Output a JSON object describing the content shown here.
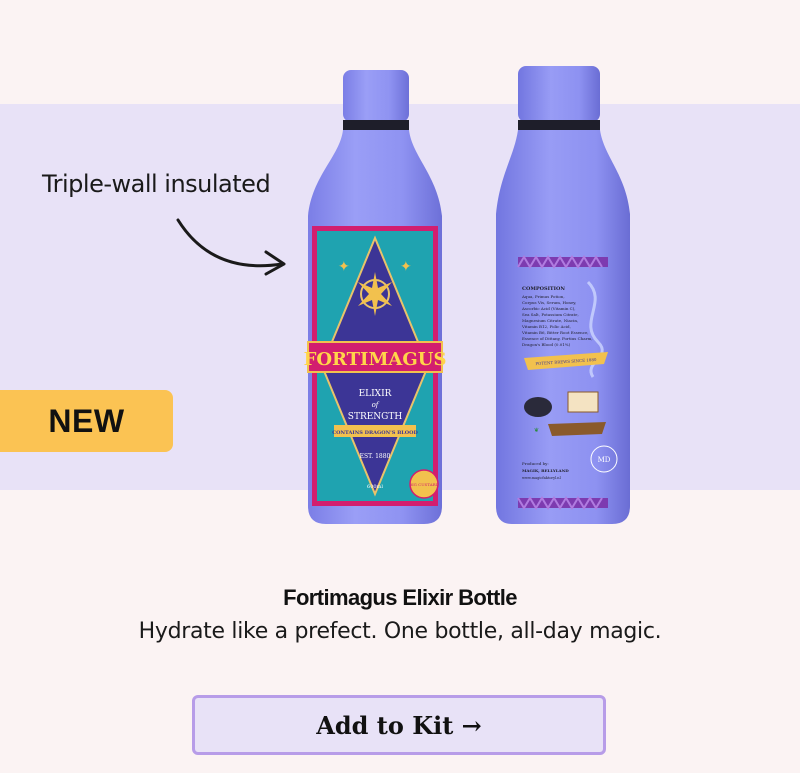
{
  "annotation": {
    "text": "Triple-wall insulated"
  },
  "badge": {
    "label": "NEW"
  },
  "product": {
    "title": "Fortimagus Elixir Bottle",
    "subtitle": "Hydrate like a prefect. One bottle, all-day magic.",
    "bottle_color": "#8f93f2"
  },
  "label_front": {
    "brand": "FORTIMAGUS",
    "line1": "ELIXIR",
    "line2": "of",
    "line3": "STRENGTH",
    "ribbon": "CONTAINS DRAGON'S BLOOD",
    "est": "EST. 1880",
    "volume": "600ml",
    "seal": "BIG CUSTARD"
  },
  "label_back": {
    "heading": "COMPOSITION",
    "ingredients": [
      "Aqua, Primus Potion,",
      "Corpus Vis, Serum, Honey,",
      "Ascorbic Acid (Vitamin C),",
      "Sea Salt, Potassium Citrate,",
      "Magnesium Citrate, Niacin,",
      "Vitamin B12, Folic Acid,",
      "Vitamin B6, Bitter Root Essence,",
      "Essence of Dittany, Fortius Charm,",
      "Dragon's Blood (0.01%)"
    ],
    "banner": "POTENT BREWS SINCE 1880",
    "made_by": "Produced by:",
    "address_line": "MAGIK, BELLYLAND",
    "site": "www.magicfaktoryl.nl",
    "stamp": "MD"
  },
  "cta": {
    "label": "Add to Kit →"
  },
  "colors": {
    "band": "#e8e2f7",
    "badge": "#fbc353",
    "cta_border": "#b79ce8",
    "label_teal": "#1fa3b0",
    "label_magenta": "#d21e6f",
    "label_navy": "#3c3596"
  }
}
